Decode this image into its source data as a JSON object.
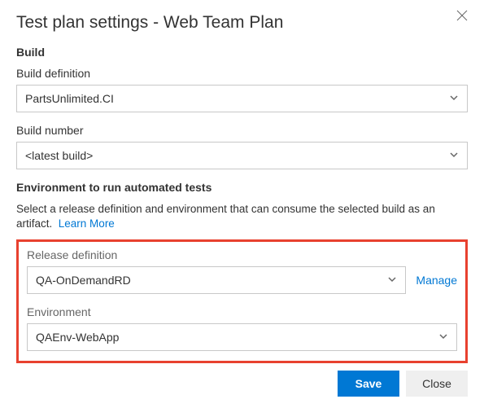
{
  "title": "Test plan settings - Web Team Plan",
  "sections": {
    "build": {
      "heading": "Build",
      "definition": {
        "label": "Build definition",
        "value": "PartsUnlimited.CI"
      },
      "number": {
        "label": "Build number",
        "value": "<latest build>"
      }
    },
    "env": {
      "heading": "Environment to run automated tests",
      "helper": "Select a release definition and environment that can consume the selected build as an artifact.",
      "learn_more": "Learn More",
      "release": {
        "label": "Release definition",
        "value": "QA-OnDemandRD",
        "manage": "Manage"
      },
      "environment": {
        "label": "Environment",
        "value": "QAEnv-WebApp"
      }
    }
  },
  "buttons": {
    "save": "Save",
    "close": "Close"
  }
}
